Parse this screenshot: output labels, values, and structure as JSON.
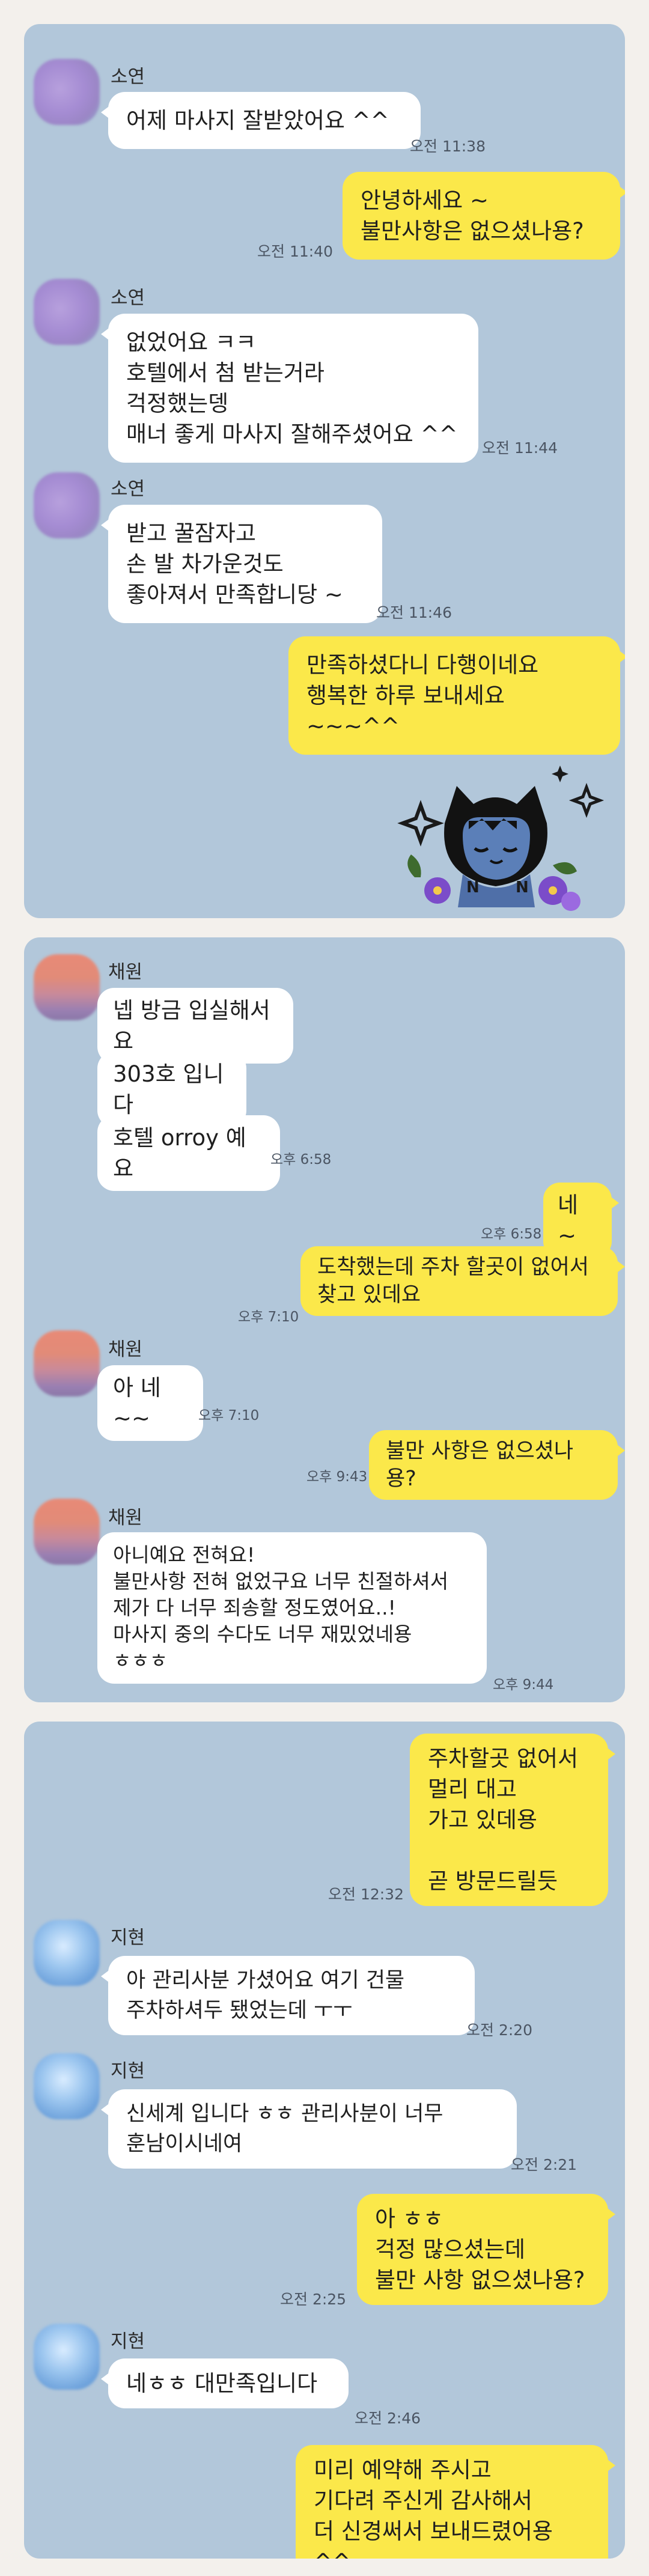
{
  "chats": [
    {
      "messages": [
        {
          "sender": "소연",
          "text": "어제 마사지 잘받았어요 ^^",
          "time": "오전 11:38"
        },
        {
          "sender": "me",
          "text": "안녕하세요 ~\n불만사항은 없으셨나용?",
          "time": "오전 11:40"
        },
        {
          "sender": "소연",
          "text": "없었어요 ㅋㅋ\n호텔에서 첨 받는거라\n걱정했는뎅\n매너 좋게 마사지 잘해주셨어요 ^^",
          "time": "오전 11:44"
        },
        {
          "sender": "소연",
          "text": "받고 꿀잠자고\n손 발 차가운것도\n좋아져서 만족합니당 ~",
          "time": "오전 11:46"
        },
        {
          "sender": "me",
          "text": "만족하셨다니 다행이네요\n행복한 하루 보내세요 ~~~^^"
        }
      ],
      "sticker": "sleeping-character-sticker"
    },
    {
      "messages": [
        {
          "sender": "채원",
          "text": "넵 방금 입실해서요"
        },
        {
          "sender": "채원",
          "text": "303호 입니다"
        },
        {
          "sender": "채원",
          "text": "호텔 orroy 예요",
          "time": "오후 6:58"
        },
        {
          "sender": "me",
          "text": "네 ~",
          "time": "오후 6:58"
        },
        {
          "sender": "me",
          "text": "도착했는데  주차 할곳이 없어서\n찾고 있데요",
          "time": "오후 7:10"
        },
        {
          "sender": "채원",
          "text": "아 네~~",
          "time": "오후 7:10"
        },
        {
          "sender": "me",
          "text": "불만 사항은 없으셨나용?",
          "time": "오후 9:43"
        },
        {
          "sender": "채원",
          "text": "아니예요 전혀요!\n불만사항 전혀 없었구요 너무 친절하셔서\n제가 다 너무 죄송할 정도였어요..!\n마사지 중의 수다도 너무 재밌었네용\nㅎㅎㅎ",
          "time": "오후 9:44"
        }
      ]
    },
    {
      "messages": [
        {
          "sender": "me",
          "text": "주차할곳 없어서\n멀리 대고\n가고 있데용\n\n곧 방문드릴듯",
          "time": "오전 12:32"
        },
        {
          "sender": "지현",
          "text": "아 관리사분 가셨어요 여기 건물\n주차하셔두 됐었는데 ㅜㅜ",
          "time": "오전 2:20"
        },
        {
          "sender": "지현",
          "text": "신세계 입니다 ㅎㅎ 관리사분이 너무\n훈남이시네여",
          "time": "오전 2:21"
        },
        {
          "sender": "me",
          "text": "아 ㅎㅎ\n걱정 많으셨는데\n불만 사항 없으셨나용?",
          "time": "오전 2:25"
        },
        {
          "sender": "지현",
          "text": "네ㅎㅎ 대만족입니다",
          "time": "오전 2:46"
        },
        {
          "sender": "me",
          "text": "미리 예약해 주시고\n기다려 주신게 감사해서\n더 신경써서 보내드렸어용 ^^"
        }
      ]
    }
  ]
}
